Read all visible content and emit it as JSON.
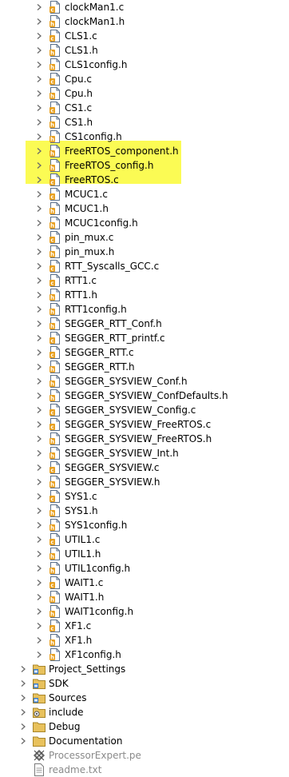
{
  "tree": {
    "files": [
      {
        "label": "clockMan1.c",
        "icon": "c-source-file-icon"
      },
      {
        "label": "clockMan1.h",
        "icon": "header-file-icon"
      },
      {
        "label": "CLS1.c",
        "icon": "c-source-file-icon"
      },
      {
        "label": "CLS1.h",
        "icon": "header-file-icon"
      },
      {
        "label": "CLS1config.h",
        "icon": "header-file-icon"
      },
      {
        "label": "Cpu.c",
        "icon": "c-source-file-icon"
      },
      {
        "label": "Cpu.h",
        "icon": "header-file-icon"
      },
      {
        "label": "CS1.c",
        "icon": "c-source-file-icon"
      },
      {
        "label": "CS1.h",
        "icon": "header-file-icon"
      },
      {
        "label": "CS1config.h",
        "icon": "header-file-icon"
      },
      {
        "label": "FreeRTOS_component.h",
        "icon": "header-file-icon",
        "highlighted": true
      },
      {
        "label": "FreeRTOS_config.h",
        "icon": "header-file-icon",
        "highlighted": true
      },
      {
        "label": "FreeRTOS.c",
        "icon": "c-source-file-icon",
        "highlighted": true
      },
      {
        "label": "MCUC1.c",
        "icon": "c-source-file-icon"
      },
      {
        "label": "MCUC1.h",
        "icon": "header-file-icon"
      },
      {
        "label": "MCUC1config.h",
        "icon": "header-file-icon"
      },
      {
        "label": "pin_mux.c",
        "icon": "c-source-file-icon"
      },
      {
        "label": "pin_mux.h",
        "icon": "header-file-icon"
      },
      {
        "label": "RTT_Syscalls_GCC.c",
        "icon": "c-source-file-icon"
      },
      {
        "label": "RTT1.c",
        "icon": "c-source-file-icon"
      },
      {
        "label": "RTT1.h",
        "icon": "header-file-icon"
      },
      {
        "label": "RTT1config.h",
        "icon": "header-file-icon"
      },
      {
        "label": "SEGGER_RTT_Conf.h",
        "icon": "header-file-icon"
      },
      {
        "label": "SEGGER_RTT_printf.c",
        "icon": "c-source-file-icon"
      },
      {
        "label": "SEGGER_RTT.c",
        "icon": "c-source-file-icon"
      },
      {
        "label": "SEGGER_RTT.h",
        "icon": "header-file-icon"
      },
      {
        "label": "SEGGER_SYSVIEW_Conf.h",
        "icon": "header-file-icon"
      },
      {
        "label": "SEGGER_SYSVIEW_ConfDefaults.h",
        "icon": "header-file-icon"
      },
      {
        "label": "SEGGER_SYSVIEW_Config.c",
        "icon": "c-source-file-icon"
      },
      {
        "label": "SEGGER_SYSVIEW_FreeRTOS.c",
        "icon": "c-source-file-icon"
      },
      {
        "label": "SEGGER_SYSVIEW_FreeRTOS.h",
        "icon": "header-file-icon"
      },
      {
        "label": "SEGGER_SYSVIEW_Int.h",
        "icon": "header-file-icon"
      },
      {
        "label": "SEGGER_SYSVIEW.c",
        "icon": "c-source-file-icon"
      },
      {
        "label": "SEGGER_SYSVIEW.h",
        "icon": "header-file-icon"
      },
      {
        "label": "SYS1.c",
        "icon": "c-source-file-icon"
      },
      {
        "label": "SYS1.h",
        "icon": "header-file-icon"
      },
      {
        "label": "SYS1config.h",
        "icon": "header-file-icon"
      },
      {
        "label": "UTIL1.c",
        "icon": "c-source-file-icon"
      },
      {
        "label": "UTIL1.h",
        "icon": "header-file-icon"
      },
      {
        "label": "UTIL1config.h",
        "icon": "header-file-icon"
      },
      {
        "label": "WAIT1.c",
        "icon": "c-source-file-icon"
      },
      {
        "label": "WAIT1.h",
        "icon": "header-file-icon"
      },
      {
        "label": "WAIT1config.h",
        "icon": "header-file-icon"
      },
      {
        "label": "XF1.c",
        "icon": "c-source-file-icon"
      },
      {
        "label": "XF1.h",
        "icon": "header-file-icon"
      },
      {
        "label": "XF1config.h",
        "icon": "header-file-icon"
      }
    ],
    "folders": [
      {
        "label": "Project_Settings",
        "icon": "source-folder-icon"
      },
      {
        "label": "SDK",
        "icon": "source-folder-icon"
      },
      {
        "label": "Sources",
        "icon": "source-folder-icon"
      },
      {
        "label": "include",
        "icon": "include-folder-icon"
      },
      {
        "label": "Debug",
        "icon": "folder-icon"
      },
      {
        "label": "Documentation",
        "icon": "folder-icon"
      }
    ],
    "root_files": [
      {
        "label": "ProcessorExpert.pe",
        "icon": "processor-expert-icon"
      },
      {
        "label": "readme.txt",
        "icon": "text-file-icon"
      }
    ]
  },
  "colors": {
    "highlight": "#fbfb54",
    "chevron": "#6a6a6a",
    "dimmed_text": "#8a8a8a"
  }
}
